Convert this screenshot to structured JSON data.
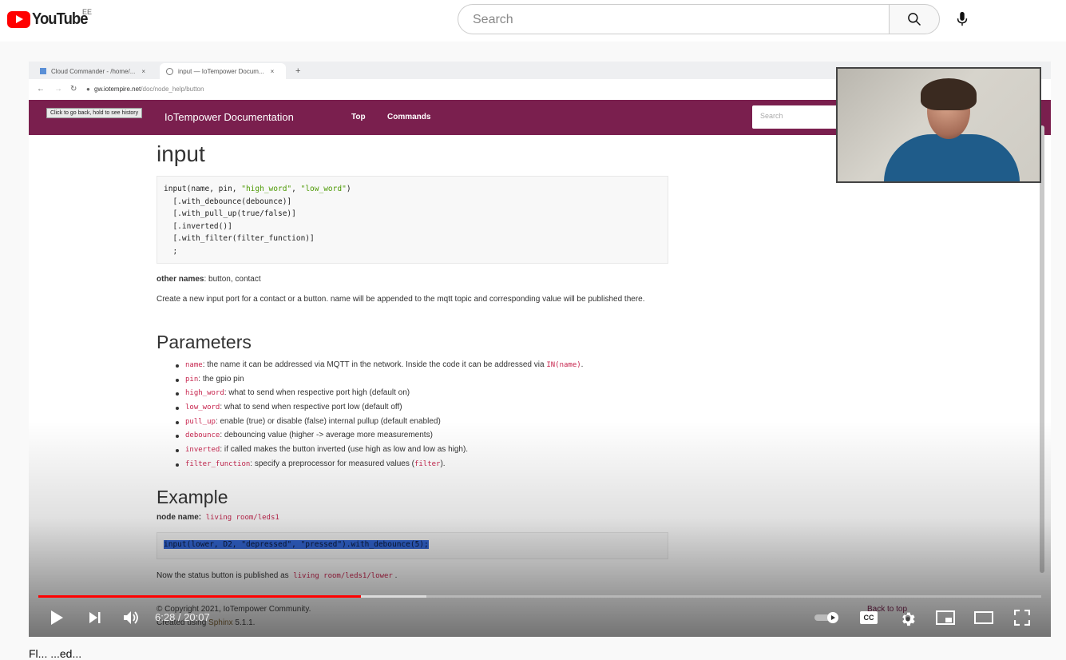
{
  "header": {
    "logo_text": "YouTube",
    "country_code": "EE",
    "search_placeholder": "Search"
  },
  "browser": {
    "tabs": [
      {
        "label": "Cloud Commander - /home/...",
        "close": "×"
      },
      {
        "label": "input — IoTempower Docum...",
        "close": "×"
      }
    ],
    "new_tab": "+",
    "url_host": "gw.iotempire.net",
    "url_path": "/doc/node_help/button",
    "tooltip": "Click to go back, hold to see history"
  },
  "doc": {
    "site_title": "IoTempower Documentation",
    "nav_links": [
      "Top",
      "Commands"
    ],
    "search_placeholder": "Search",
    "title": "input",
    "code_lines": [
      "input(name, pin, \"high_word\", \"low_word\")",
      "  [.with_debounce(debounce)]",
      "  [.with_pull_up(true/false)]",
      "  [.inverted()]",
      "  [.with_filter(filter_function)]",
      "  ;"
    ],
    "other_names_label": "other names",
    "other_names_value": ": button, contact",
    "description": "Create a new input port for a contact or a button. name will be appended to the mqtt topic and corresponding value will be published there.",
    "parameters_heading": "Parameters",
    "parameters": [
      {
        "name": "name",
        "desc": ": the name it can be addressed via MQTT in the network. Inside the code it can be addressed via ",
        "extra": "IN(name)",
        "after": "."
      },
      {
        "name": "pin",
        "desc": ": the gpio pin"
      },
      {
        "name": "high_word",
        "desc": ": what to send when respective port high (default on)"
      },
      {
        "name": "low_word",
        "desc": ": what to send when respective port low (default off)"
      },
      {
        "name": "pull_up",
        "desc": ": enable (true) or disable (false) internal pullup (default enabled)"
      },
      {
        "name": "debounce",
        "desc": ": debouncing value (higher -> average more measurements)"
      },
      {
        "name": "inverted",
        "desc": ": if called makes the button inverted (use high as low and low as high)."
      },
      {
        "name": "filter_function",
        "desc": ": specify a preprocessor for measured values (",
        "extra": "filter",
        "after": ")."
      }
    ],
    "example_heading": "Example",
    "node_name_label": "node name:",
    "node_name_value": "living room/leds1",
    "example_code": "input(lower, D2, \"depressed\", \"pressed\").with_debounce(5);",
    "status_text": "Now the status button is published as",
    "status_topic": "living room/leds1/lower",
    "status_after": ".",
    "copyright": "© Copyright 2021, IoTempower Community.",
    "created_using_prefix": "Created using",
    "created_using_link": "Sphinx",
    "created_using_version": "5.1.1.",
    "back_to_top": "Back to top"
  },
  "player": {
    "current_time": "6:28",
    "duration": "20:07",
    "time_display": "6:28 / 20:07",
    "progress_played_fraction": 0.322,
    "progress_loaded_fraction": 0.387,
    "controls": [
      "play",
      "next",
      "volume",
      "autoplay",
      "subtitles",
      "settings",
      "miniplayer",
      "theater",
      "fullscreen"
    ],
    "cc_label": "CC"
  },
  "below": {
    "title_fragment": "Fl... ...ed..."
  },
  "colors": {
    "brand_red": "#ff0000",
    "doc_nav_bg": "#7a1f4e",
    "selection": "#3367d6"
  }
}
